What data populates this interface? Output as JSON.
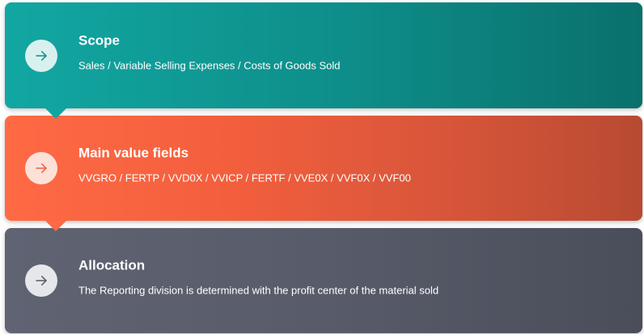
{
  "cards": [
    {
      "title": "Scope",
      "description": "Sales / Variable Selling Expenses / Costs of Goods Sold",
      "icon": "arrow-right-icon",
      "color": "#12a7a2"
    },
    {
      "title": "Main value fields",
      "description": "VVGRO / FERTP / VVD0X / VVICP / FERTF / VVE0X / VVF0X / VVF00",
      "icon": "arrow-right-icon",
      "color": "#ff6a45"
    },
    {
      "title": "Allocation",
      "description": "The Reporting division is determined with the profit center of the material sold",
      "icon": "arrow-right-icon",
      "color": "#5f6372"
    }
  ]
}
